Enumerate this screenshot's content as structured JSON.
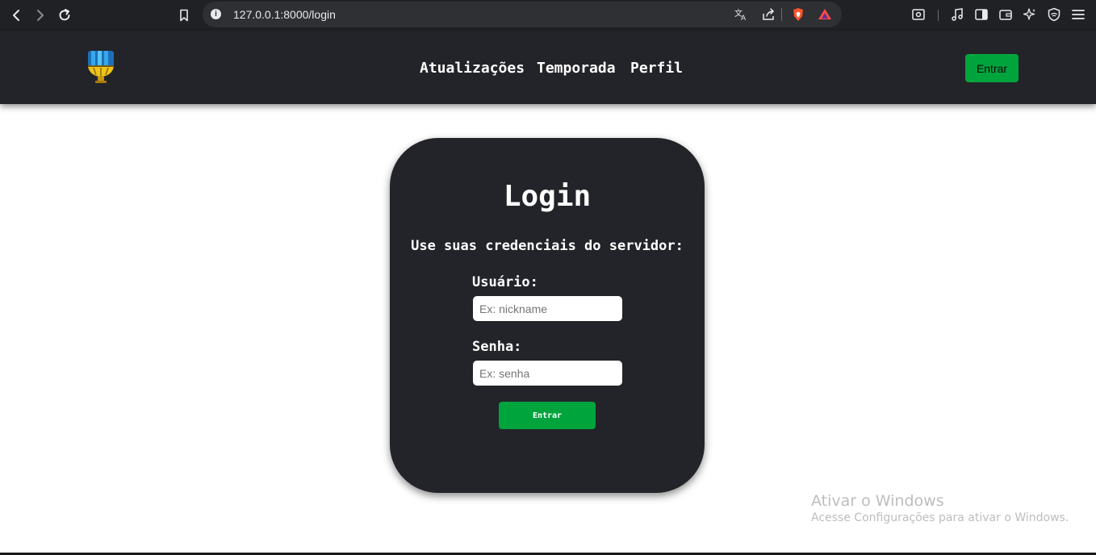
{
  "browser": {
    "url": "127.0.0.1:8000/login",
    "icons": [
      "back-icon",
      "forward-icon",
      "reload-icon",
      "bookmark-icon",
      "site-info-icon",
      "translate-icon",
      "share-icon",
      "brave-shields-icon",
      "brave-rewards-icon",
      "screenshot-icon",
      "music-icon",
      "sidebar-icon",
      "wallet-icon",
      "leo-ai-icon",
      "vpn-icon",
      "menu-icon"
    ]
  },
  "header": {
    "nav": [
      "Atualizações",
      "Temporada",
      "Perfil"
    ],
    "login_button": "Entrar"
  },
  "login": {
    "title": "Login",
    "subtitle": "Use suas credenciais do servidor:",
    "username_label": "Usuário:",
    "username_placeholder": "Ex: nickname",
    "password_label": "Senha:",
    "password_placeholder": "Ex: senha",
    "submit": "Entrar"
  },
  "watermark": {
    "title": "Ativar o Windows",
    "subtitle": "Acesse Configurações para ativar o Windows."
  },
  "colors": {
    "dark": "#232429",
    "accent_green": "#00a43d",
    "chrome": "#202124"
  }
}
